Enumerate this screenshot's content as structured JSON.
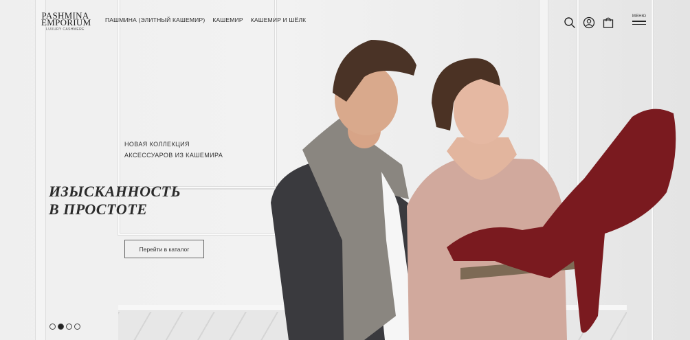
{
  "logo": {
    "line1": "PASHMINA",
    "line2": "EMPORIUM",
    "tagline": "LUXURY CASHMERE"
  },
  "nav": [
    {
      "label": "ПАШМИНА (ЭЛИТНЫЙ КАШЕМИР)"
    },
    {
      "label": "КАШЕМИР"
    },
    {
      "label": "КАШЕМИР И ШЁЛК"
    }
  ],
  "header_icons": [
    "search-icon",
    "account-icon",
    "cart-icon"
  ],
  "menu": {
    "label": "МЕНЮ"
  },
  "hero": {
    "kicker_line1": "НОВАЯ КОЛЛЕКЦИЯ",
    "kicker_line2": "АКСЕССУАРОВ ИЗ КАШЕМИРА",
    "headline_line1": "ИЗЫСКАННОСТЬ",
    "headline_line2": "В ПРОСТОТЕ",
    "cta_label": "Перейти в каталог"
  },
  "slider": {
    "total": 4,
    "active": 2
  },
  "colors": {
    "scarf": "#7a1a1f",
    "text": "#2b2b2b",
    "wall": "#efefef"
  }
}
